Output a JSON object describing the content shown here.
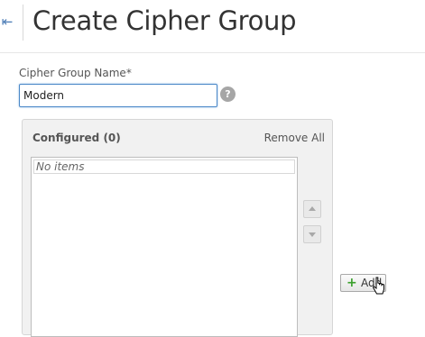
{
  "header": {
    "back_icon": "back-arrow-icon",
    "title": "Create Cipher Group"
  },
  "form": {
    "name_label": "Cipher Group Name*",
    "name_value": "Modern",
    "help_icon": "?"
  },
  "configured": {
    "title": "Configured (0)",
    "remove_all_label": "Remove All",
    "empty_text": "No items",
    "move_up_icon": "triangle-up-icon",
    "move_down_icon": "triangle-down-icon"
  },
  "add_button": {
    "icon": "+",
    "label": "Add"
  },
  "colors": {
    "accent": "#4a88c8",
    "add_icon": "#3aa02c"
  }
}
